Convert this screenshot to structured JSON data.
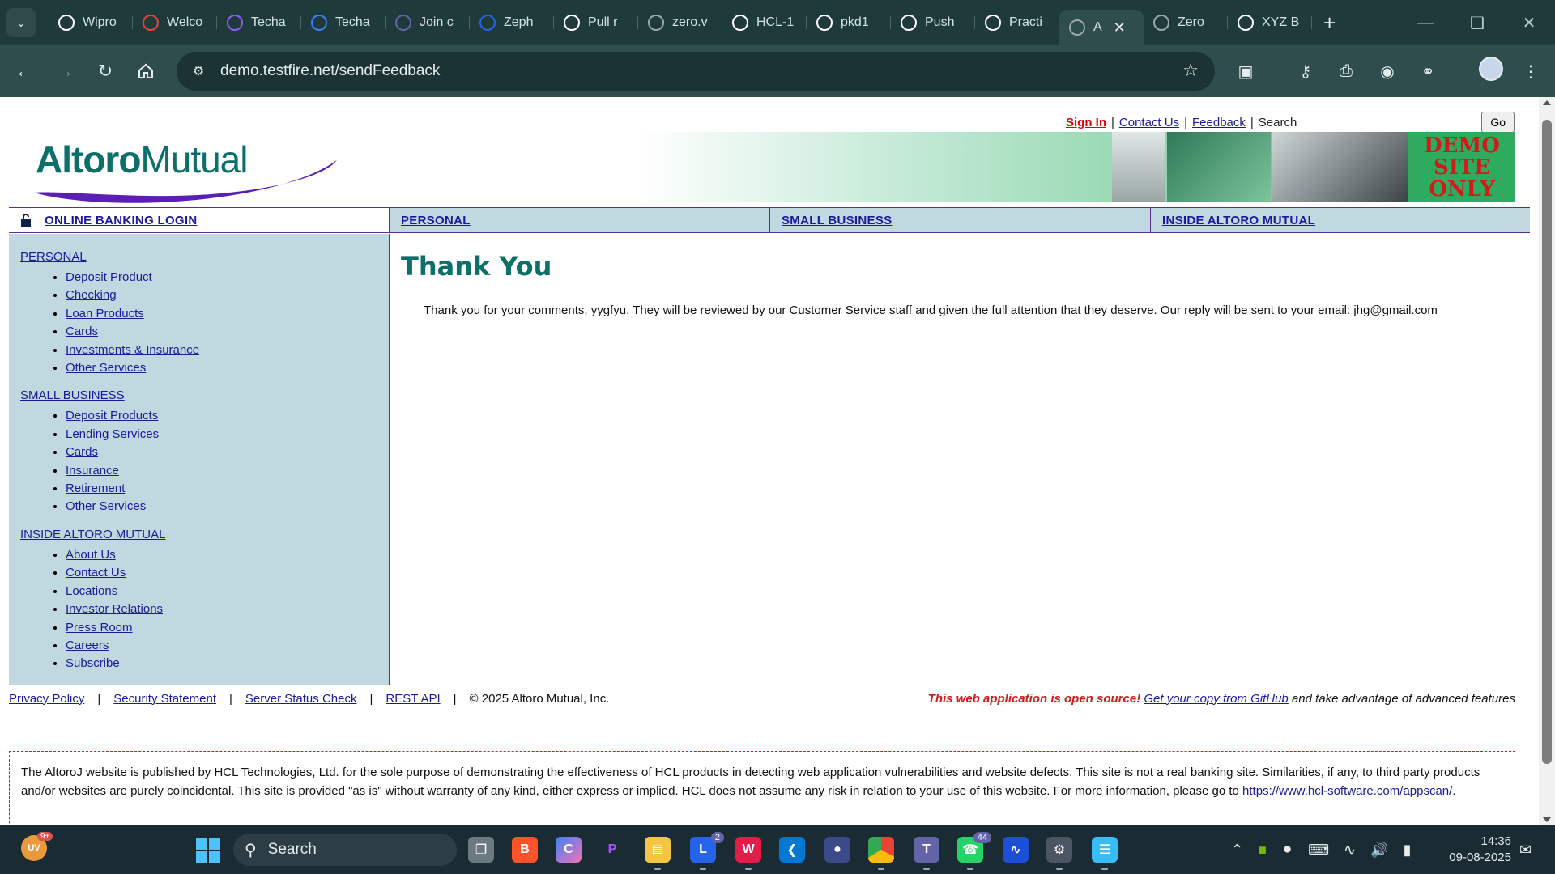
{
  "browser": {
    "tabs": [
      {
        "label": "Wipro",
        "icon": "github-icon",
        "color": "#ffffff"
      },
      {
        "label": "Welco",
        "icon": "gmail-icon",
        "color": "#ea4335"
      },
      {
        "label": "Techa",
        "icon": "techademy-icon",
        "color": "#8b5cf6"
      },
      {
        "label": "Techa",
        "icon": "chart-line-icon",
        "color": "#3b82f6"
      },
      {
        "label": "Join c",
        "icon": "teams-icon",
        "color": "#6264a7"
      },
      {
        "label": "Zeph",
        "icon": "zephyr-icon",
        "color": "#2563eb"
      },
      {
        "label": "Pull r",
        "icon": "github-icon",
        "color": "#ffffff"
      },
      {
        "label": "zero.v",
        "icon": "globe-icon",
        "color": "#9aa8ae"
      },
      {
        "label": "HCL-1",
        "icon": "github-icon",
        "color": "#ffffff"
      },
      {
        "label": "pkd1",
        "icon": "github-icon",
        "color": "#ffffff"
      },
      {
        "label": "Push",
        "icon": "openai-icon",
        "color": "#ffffff"
      },
      {
        "label": "Practi",
        "icon": "practice-icon",
        "color": "#ffffff"
      },
      {
        "label": "A",
        "icon": "globe-icon",
        "color": "#9aa8ae",
        "active": true
      },
      {
        "label": "Zero",
        "icon": "globe-icon",
        "color": "#9aa8ae"
      },
      {
        "label": "XYZ B",
        "icon": "wordpress-icon",
        "color": "#ffffff"
      }
    ],
    "url": "demo.testfire.net/sendFeedback"
  },
  "header": {
    "logo_part1": "Altoro",
    "logo_part2": "Mutual",
    "signin": "Sign In",
    "contact": "Contact Us",
    "feedback": "Feedback",
    "search_label": "Search",
    "search_value": "",
    "go": "Go",
    "demo_line1": "DEMO",
    "demo_line2": "SITE",
    "demo_line3": "ONLY"
  },
  "nav": {
    "login": "ONLINE BANKING LOGIN",
    "personal": "PERSONAL",
    "small_business": "SMALL BUSINESS",
    "inside": "INSIDE ALTORO MUTUAL"
  },
  "sidebar": {
    "sections": [
      {
        "title": "PERSONAL",
        "items": [
          "Deposit Product",
          "Checking",
          "Loan Products",
          "Cards",
          "Investments & Insurance",
          "Other Services"
        ]
      },
      {
        "title": "SMALL BUSINESS",
        "items": [
          "Deposit Products",
          "Lending Services",
          "Cards",
          "Insurance",
          "Retirement",
          "Other Services"
        ]
      },
      {
        "title": "INSIDE ALTORO MUTUAL",
        "items": [
          "About Us",
          "Contact Us",
          "Locations",
          "Investor Relations",
          "Press Room",
          "Careers",
          "Subscribe"
        ]
      }
    ]
  },
  "main": {
    "title": "Thank You",
    "message": "Thank you for your comments, yygfyu. They will be reviewed by our Customer Service staff and given the full attention that they deserve. Our reply will be sent to your email: jhg@gmail.com"
  },
  "footer": {
    "privacy": "Privacy Policy",
    "security": "Security Statement",
    "status": "Server Status Check",
    "rest": "REST API",
    "copyright": "© 2025 Altoro Mutual, Inc.",
    "oss_note": "This web application is open source!",
    "github_link": "Get your copy from GitHub",
    "oss_tail": "and take advantage of advanced features"
  },
  "disclaimer": {
    "text": "The AltoroJ website is published by HCL Technologies, Ltd. for the sole purpose of demonstrating the effectiveness of HCL products in detecting web application vulnerabilities and website defects. This site is not a real banking site. Similarities, if any, to third party products and/or websites are purely coincidental. This site is provided \"as is\" without warranty of any kind, either express or implied. HCL does not assume any risk in relation to your use of this website. For more information, please go to",
    "link": "https://www.hcl-software.com/appscan/",
    "tail": "."
  },
  "taskbar": {
    "weather_badge": "9+",
    "search_label": "Search",
    "teams_badge": "2",
    "whatsapp_badge": "44",
    "time": "14:36",
    "date": "09-08-2025"
  }
}
